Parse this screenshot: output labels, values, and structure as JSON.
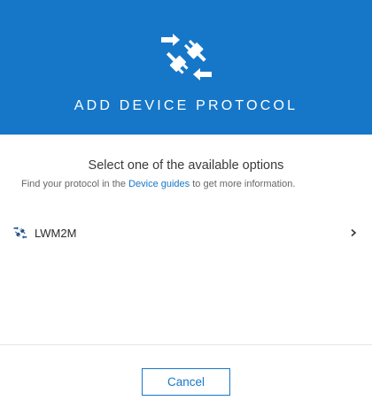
{
  "header": {
    "title": "ADD DEVICE PROTOCOL",
    "icon": "plug-connect-icon",
    "background": "#1677c8"
  },
  "main": {
    "subtitle": "Select one of the available options",
    "hint": {
      "before": "Find your protocol in the ",
      "link_text": "Device guides",
      "after": " to get more information."
    },
    "options": [
      {
        "label": "LWM2M",
        "icon": "plug-connect-icon",
        "trailing_icon": "chevron-right-icon"
      }
    ]
  },
  "footer": {
    "cancel_label": "Cancel"
  },
  "colors": {
    "accent": "#1677c8"
  }
}
